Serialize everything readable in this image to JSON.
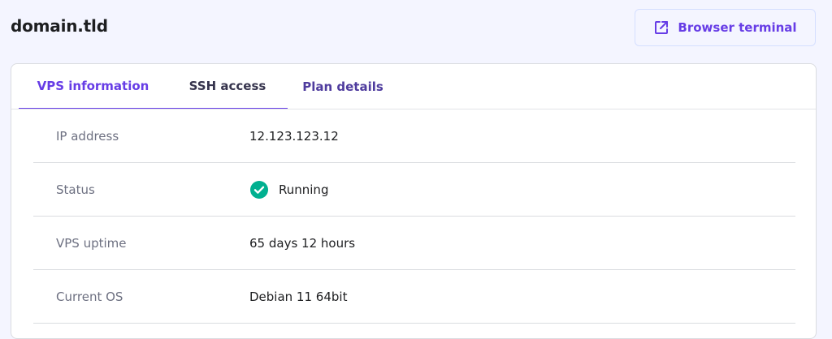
{
  "header": {
    "title": "domain.tld",
    "terminal_button": {
      "label": "Browser terminal",
      "icon": "external-link-icon"
    }
  },
  "tabs": [
    {
      "label": "VPS information",
      "active": true
    },
    {
      "label": "SSH access",
      "active": false
    },
    {
      "label": "Plan details",
      "active": false
    }
  ],
  "info": {
    "rows": [
      {
        "label": "IP address",
        "value": "12.123.123.12"
      },
      {
        "label": "Status",
        "value": "Running",
        "icon": "check-circle-icon"
      },
      {
        "label": "VPS uptime",
        "value": "65 days 12 hours"
      },
      {
        "label": "Current OS",
        "value": "Debian 11 64bit"
      }
    ]
  },
  "colors": {
    "accent": "#673de6",
    "success": "#00b090",
    "background": "#f4f5ff"
  }
}
